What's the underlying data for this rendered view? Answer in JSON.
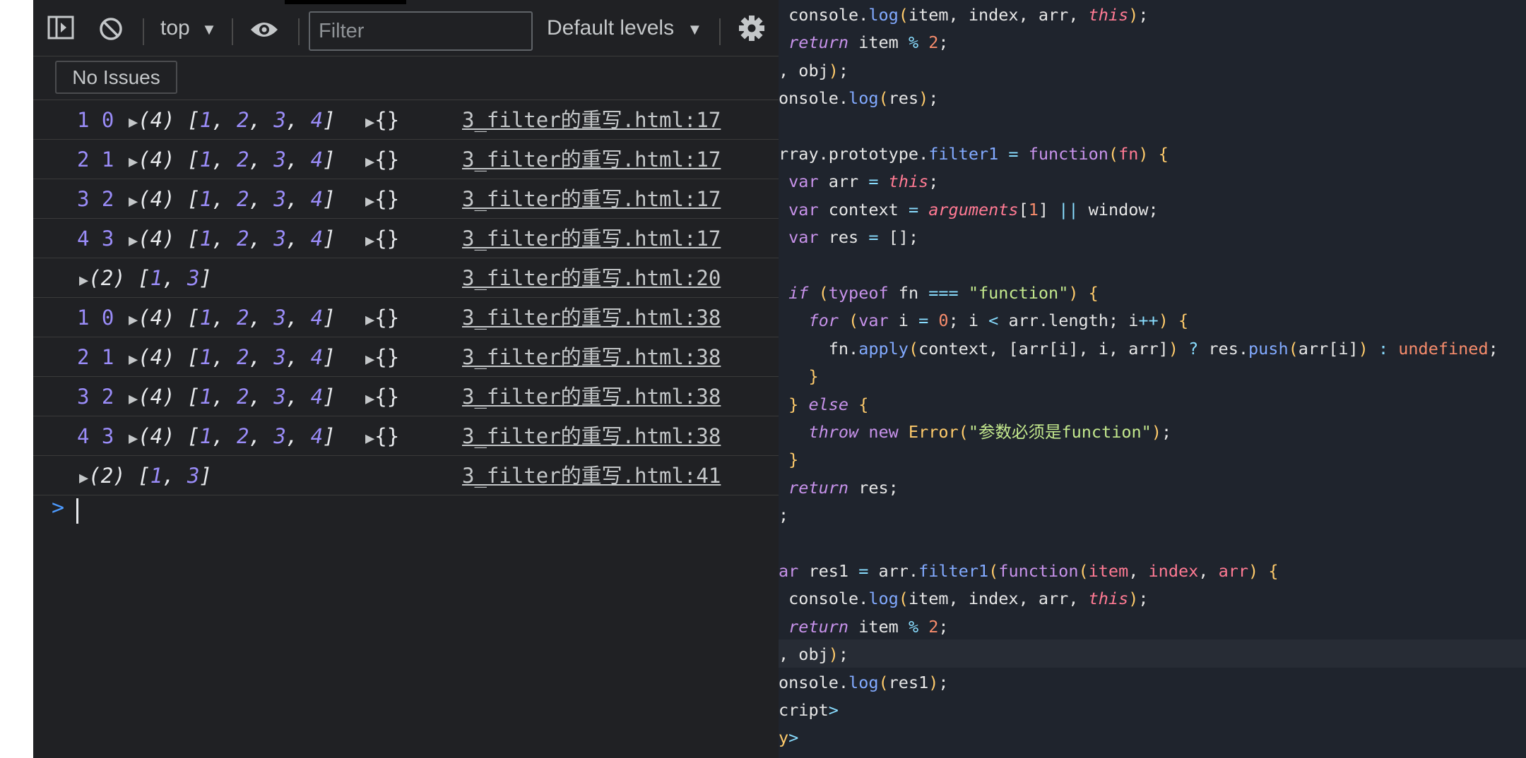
{
  "console": {
    "toolbar": {
      "context": "top",
      "filter_placeholder": "Filter",
      "levels": "Default levels"
    },
    "issues_label": "No Issues",
    "rows": [
      {
        "nums": "1 0",
        "count": "(4)",
        "arr": [
          "1",
          "2",
          "3",
          "4"
        ],
        "obj": "{}",
        "src": "3_filter的重写.html:17"
      },
      {
        "nums": "2 1",
        "count": "(4)",
        "arr": [
          "1",
          "2",
          "3",
          "4"
        ],
        "obj": "{}",
        "src": "3_filter的重写.html:17"
      },
      {
        "nums": "3 2",
        "count": "(4)",
        "arr": [
          "1",
          "2",
          "3",
          "4"
        ],
        "obj": "{}",
        "src": "3_filter的重写.html:17"
      },
      {
        "nums": "4 3",
        "count": "(4)",
        "arr": [
          "1",
          "2",
          "3",
          "4"
        ],
        "obj": "{}",
        "src": "3_filter的重写.html:17"
      },
      {
        "nums": "",
        "count": "(2)",
        "arr": [
          "1",
          "3"
        ],
        "obj": "",
        "src": "3_filter的重写.html:20"
      },
      {
        "nums": "1 0",
        "count": "(4)",
        "arr": [
          "1",
          "2",
          "3",
          "4"
        ],
        "obj": "{}",
        "src": "3_filter的重写.html:38"
      },
      {
        "nums": "2 1",
        "count": "(4)",
        "arr": [
          "1",
          "2",
          "3",
          "4"
        ],
        "obj": "{}",
        "src": "3_filter的重写.html:38"
      },
      {
        "nums": "3 2",
        "count": "(4)",
        "arr": [
          "1",
          "2",
          "3",
          "4"
        ],
        "obj": "{}",
        "src": "3_filter的重写.html:38"
      },
      {
        "nums": "4 3",
        "count": "(4)",
        "arr": [
          "1",
          "2",
          "3",
          "4"
        ],
        "obj": "{}",
        "src": "3_filter的重写.html:38"
      },
      {
        "nums": "",
        "count": "(2)",
        "arr": [
          "1",
          "3"
        ],
        "obj": "",
        "src": "3_filter的重写.html:41"
      }
    ],
    "prompt": ">"
  },
  "icons": [
    "sidebar-toggle-icon",
    "clear-console-icon",
    "dropdown-arrow-icon",
    "eye-icon",
    "gear-icon",
    "expand-triangle-icon",
    "prompt-chevron-icon"
  ],
  "colors": {
    "console_bg": "#202124",
    "editor_bg": "#1f242d",
    "console_value": "#9a8cf8",
    "keyword": "#c792ea",
    "this_kw": "#ff7a93",
    "function_name": "#82aaff",
    "string": "#c3e88d",
    "number": "#f78c6c"
  },
  "editor": {
    "lines": [
      [
        [
          "pl",
          " console."
        ],
        [
          "fn",
          "log"
        ],
        [
          "par",
          "("
        ],
        [
          "pl",
          "item, index, arr, "
        ],
        [
          "this",
          "this"
        ],
        [
          "par",
          ")"
        ],
        [
          "pl",
          ";"
        ]
      ],
      [
        [
          "kw",
          " return"
        ],
        [
          "pl",
          " item "
        ],
        [
          "op",
          "%"
        ],
        [
          "num",
          " 2"
        ],
        [
          "pl",
          ";"
        ]
      ],
      [
        [
          "pl",
          ", obj"
        ],
        [
          "par",
          ")"
        ],
        [
          "pl",
          ";"
        ]
      ],
      [
        [
          "pl",
          "onsole."
        ],
        [
          "fn",
          "log"
        ],
        [
          "par",
          "("
        ],
        [
          "pl",
          "res"
        ],
        [
          "par",
          ")"
        ],
        [
          "pl",
          ";"
        ]
      ],
      [],
      [
        [
          "pl",
          "rray.prototype."
        ],
        [
          "fn",
          "filter1"
        ],
        [
          "op",
          " = "
        ],
        [
          "kw2",
          "function"
        ],
        [
          "par",
          "("
        ],
        [
          "prm",
          "fn"
        ],
        [
          "par",
          ")"
        ],
        [
          "pl",
          " "
        ],
        [
          "par",
          "{"
        ]
      ],
      [
        [
          "kw2",
          " var"
        ],
        [
          "pl",
          " arr "
        ],
        [
          "op",
          "="
        ],
        [
          "pl",
          " "
        ],
        [
          "this",
          "this"
        ],
        [
          "pl",
          ";"
        ]
      ],
      [
        [
          "kw2",
          " var"
        ],
        [
          "pl",
          " context "
        ],
        [
          "op",
          "="
        ],
        [
          "pl",
          " "
        ],
        [
          "this",
          "arguments"
        ],
        [
          "pl",
          "["
        ],
        [
          "num",
          "1"
        ],
        [
          "pl",
          "] "
        ],
        [
          "op",
          "||"
        ],
        [
          "pl",
          " window;"
        ]
      ],
      [
        [
          "kw2",
          " var"
        ],
        [
          "pl",
          " res "
        ],
        [
          "op",
          "="
        ],
        [
          "pl",
          " [];"
        ]
      ],
      [],
      [
        [
          "kw",
          " if"
        ],
        [
          "pl",
          " "
        ],
        [
          "par",
          "("
        ],
        [
          "kw2",
          "typeof"
        ],
        [
          "pl",
          " fn "
        ],
        [
          "op",
          "==="
        ],
        [
          "pl",
          " "
        ],
        [
          "str",
          "\"function\""
        ],
        [
          "par",
          ")"
        ],
        [
          "pl",
          " "
        ],
        [
          "par",
          "{"
        ]
      ],
      [
        [
          "kw",
          "   for"
        ],
        [
          "pl",
          " "
        ],
        [
          "par",
          "("
        ],
        [
          "kw2",
          "var"
        ],
        [
          "pl",
          " i "
        ],
        [
          "op",
          "="
        ],
        [
          "pl",
          " "
        ],
        [
          "num",
          "0"
        ],
        [
          "pl",
          "; i "
        ],
        [
          "op",
          "<"
        ],
        [
          "pl",
          " arr.length; i"
        ],
        [
          "op",
          "++"
        ],
        [
          "par",
          ")"
        ],
        [
          "pl",
          " "
        ],
        [
          "par",
          "{"
        ]
      ],
      [
        [
          "pl",
          "     fn."
        ],
        [
          "fn",
          "apply"
        ],
        [
          "par",
          "("
        ],
        [
          "pl",
          "context, [arr[i], i, arr]"
        ],
        [
          "par",
          ")"
        ],
        [
          "op",
          " ?"
        ],
        [
          "pl",
          " res."
        ],
        [
          "fn",
          "push"
        ],
        [
          "par",
          "("
        ],
        [
          "pl",
          "arr[i]"
        ],
        [
          "par",
          ")"
        ],
        [
          "op",
          " :"
        ],
        [
          "undef",
          " undefined"
        ],
        [
          "pl",
          ";"
        ]
      ],
      [
        [
          "par",
          "   }"
        ]
      ],
      [
        [
          "par",
          " }"
        ],
        [
          "kw",
          " else"
        ],
        [
          "pl",
          " "
        ],
        [
          "par",
          "{"
        ]
      ],
      [
        [
          "kw",
          "   throw"
        ],
        [
          "kw2",
          " new"
        ],
        [
          "cls",
          " Error"
        ],
        [
          "par",
          "("
        ],
        [
          "str",
          "\"参数必须是function\""
        ],
        [
          "par",
          ")"
        ],
        [
          "pl",
          ";"
        ]
      ],
      [
        [
          "par",
          " }"
        ]
      ],
      [
        [
          "kw",
          " return"
        ],
        [
          "pl",
          " res;"
        ]
      ],
      [
        [
          "pl",
          ";"
        ]
      ],
      [],
      [
        [
          "kw2",
          "ar"
        ],
        [
          "pl",
          " res1 "
        ],
        [
          "op",
          "="
        ],
        [
          "pl",
          " arr."
        ],
        [
          "fn",
          "filter1"
        ],
        [
          "par",
          "("
        ],
        [
          "kw2",
          "function"
        ],
        [
          "par",
          "("
        ],
        [
          "prm",
          "item"
        ],
        [
          "pl",
          ", "
        ],
        [
          "prm",
          "index"
        ],
        [
          "pl",
          ", "
        ],
        [
          "prm",
          "arr"
        ],
        [
          "par",
          ")"
        ],
        [
          "pl",
          " "
        ],
        [
          "par",
          "{"
        ]
      ],
      [
        [
          "pl",
          " console."
        ],
        [
          "fn",
          "log"
        ],
        [
          "par",
          "("
        ],
        [
          "pl",
          "item, index, arr, "
        ],
        [
          "this",
          "this"
        ],
        [
          "par",
          ")"
        ],
        [
          "pl",
          ";"
        ]
      ],
      [
        [
          "kw",
          " return"
        ],
        [
          "pl",
          " item "
        ],
        [
          "op",
          "%"
        ],
        [
          "num",
          " 2"
        ],
        [
          "pl",
          ";"
        ]
      ],
      [
        [
          "pl",
          ", obj"
        ],
        [
          "par",
          ")"
        ],
        [
          "pl",
          ";"
        ]
      ],
      [
        [
          "pl",
          "onsole."
        ],
        [
          "fn",
          "log"
        ],
        [
          "par",
          "("
        ],
        [
          "pl",
          "res1"
        ],
        [
          "par",
          ")"
        ],
        [
          "pl",
          ";"
        ]
      ],
      [
        [
          "pl",
          "cript"
        ],
        [
          "op",
          ">"
        ]
      ],
      [
        [
          "cls",
          "y"
        ],
        [
          "op",
          ">"
        ]
      ]
    ]
  }
}
